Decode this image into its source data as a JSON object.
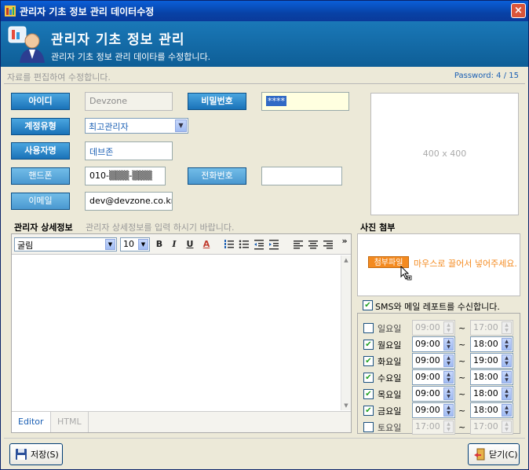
{
  "window": {
    "title": "관리자 기초 정보 관리 데이터수정",
    "close_label": "×"
  },
  "banner": {
    "title": "관리자 기초 정보 관리",
    "subtitle": "관리자 기초 정보 관리 데이타를 수정합니다."
  },
  "infobar": {
    "hint": "자료를 편집하여 수정합니다.",
    "password_counter": "Password: 4 / 15"
  },
  "form": {
    "id_label": "아이디",
    "id_value": "Devzone",
    "password_label": "비밀번호",
    "password_value": "****",
    "account_type_label": "계정유형",
    "account_type_value": "최고관리자",
    "username_label": "사용자명",
    "username_value": "데브존",
    "phone_label": "핸드폰",
    "phone_value": "010-▒▒▒-▒▒▒",
    "tel_label": "전화번호",
    "tel_value": "",
    "email_label": "이메일",
    "email_value": "dev@devzone.co.kr"
  },
  "photo": {
    "placeholder": "400 x 400",
    "attach_title": "사진 첨부",
    "attach_button": "첨부파일",
    "attach_hint": "마우스로 끌어서 넣어주세요."
  },
  "detail": {
    "title": "관리자 상세정보",
    "hint": "관리자 상세정보를 입력 하시기 바랍니다.",
    "font_value": "굴림",
    "size_value": "10",
    "toolbar": {
      "bold": "B",
      "italic": "I",
      "underline": "U",
      "color": "A",
      "more": "»"
    },
    "modes": [
      "Editor",
      "HTML"
    ]
  },
  "sms": {
    "label": "SMS와 메일 레포트를 수신합니다.",
    "checked": true
  },
  "schedule": [
    {
      "day": "일요일",
      "checked": false,
      "start": "09:00",
      "end": "17:00"
    },
    {
      "day": "월요일",
      "checked": true,
      "start": "09:00",
      "end": "18:00"
    },
    {
      "day": "화요일",
      "checked": true,
      "start": "09:00",
      "end": "19:00"
    },
    {
      "day": "수요일",
      "checked": true,
      "start": "09:00",
      "end": "18:00"
    },
    {
      "day": "목요일",
      "checked": true,
      "start": "09:00",
      "end": "18:00"
    },
    {
      "day": "금요일",
      "checked": true,
      "start": "09:00",
      "end": "18:00"
    },
    {
      "day": "토요일",
      "checked": false,
      "start": "17:00",
      "end": "17:00"
    }
  ],
  "buttons": {
    "save": "저장(S)",
    "close": "닫기(C)"
  },
  "colors": {
    "accent": "#1a72b8",
    "title_bar": "#0842a6",
    "attach": "#f48a1f"
  },
  "schedule_separator": "~"
}
